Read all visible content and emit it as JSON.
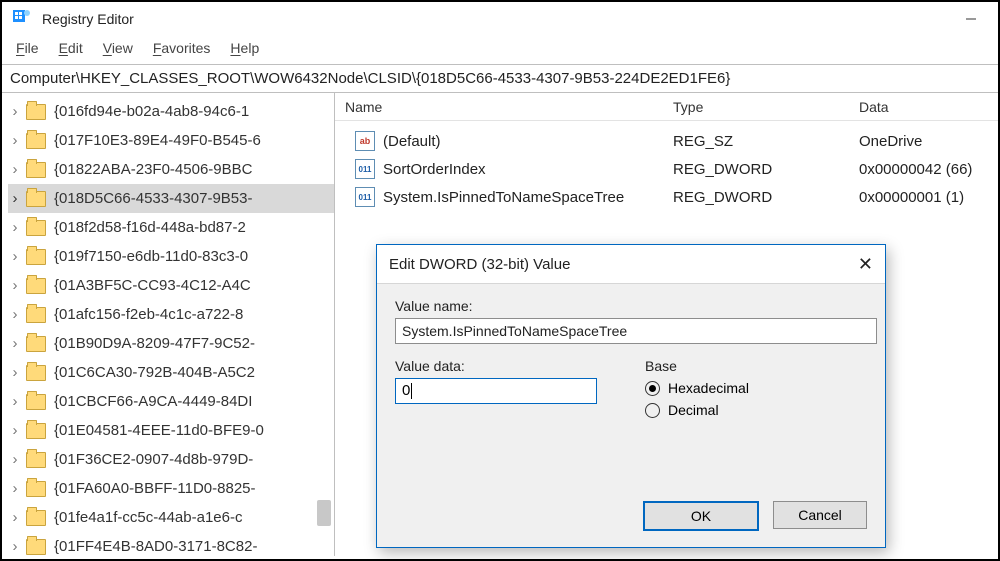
{
  "app": {
    "title": "Registry Editor"
  },
  "menu": [
    {
      "u": "F",
      "rest": "ile"
    },
    {
      "u": "E",
      "rest": "dit"
    },
    {
      "u": "V",
      "rest": "iew"
    },
    {
      "u": "F",
      "rest": "avorites",
      "pre": ""
    },
    {
      "u": "H",
      "rest": "elp"
    }
  ],
  "address": "Computer\\HKEY_CLASSES_ROOT\\WOW6432Node\\CLSID\\{018D5C66-4533-4307-9B53-224DE2ED1FE6}",
  "tree": [
    "{016fd94e-b02a-4ab8-94c6-1",
    "{017F10E3-89E4-49F0-B545-6",
    "{01822ABA-23F0-4506-9BBC",
    "{018D5C66-4533-4307-9B53-",
    "{018f2d58-f16d-448a-bd87-2",
    "{019f7150-e6db-11d0-83c3-0",
    "{01A3BF5C-CC93-4C12-A4C",
    "{01afc156-f2eb-4c1c-a722-8",
    "{01B90D9A-8209-47F7-9C52-",
    "{01C6CA30-792B-404B-A5C2",
    "{01CBCF66-A9CA-4449-84DI",
    "{01E04581-4EEE-11d0-BFE9-0",
    "{01F36CE2-0907-4d8b-979D-",
    "{01FA60A0-BBFF-11D0-8825-",
    "{01fe4a1f-cc5c-44ab-a1e6-c",
    "{01FF4E4B-8AD0-3171-8C82-"
  ],
  "treeSelectedIndex": 3,
  "list": {
    "headers": {
      "name": "Name",
      "type": "Type",
      "data": "Data"
    },
    "rows": [
      {
        "icon": "str",
        "iconText": "ab",
        "name": "(Default)",
        "type": "REG_SZ",
        "data": "OneDrive"
      },
      {
        "icon": "dw",
        "iconText": "011",
        "name": "SortOrderIndex",
        "type": "REG_DWORD",
        "data": "0x00000042 (66)"
      },
      {
        "icon": "dw",
        "iconText": "011",
        "name": "System.IsPinnedToNameSpaceTree",
        "type": "REG_DWORD",
        "data": "0x00000001 (1)"
      }
    ]
  },
  "dialog": {
    "title": "Edit DWORD (32-bit) Value",
    "valueNameLabel": "Value name:",
    "valueName": "System.IsPinnedToNameSpaceTree",
    "valueDataLabel": "Value data:",
    "valueData": "0",
    "baseLabel": "Base",
    "hexLabel": "Hexadecimal",
    "decLabel": "Decimal",
    "baseSelected": "hex",
    "ok": "OK",
    "cancel": "Cancel"
  }
}
